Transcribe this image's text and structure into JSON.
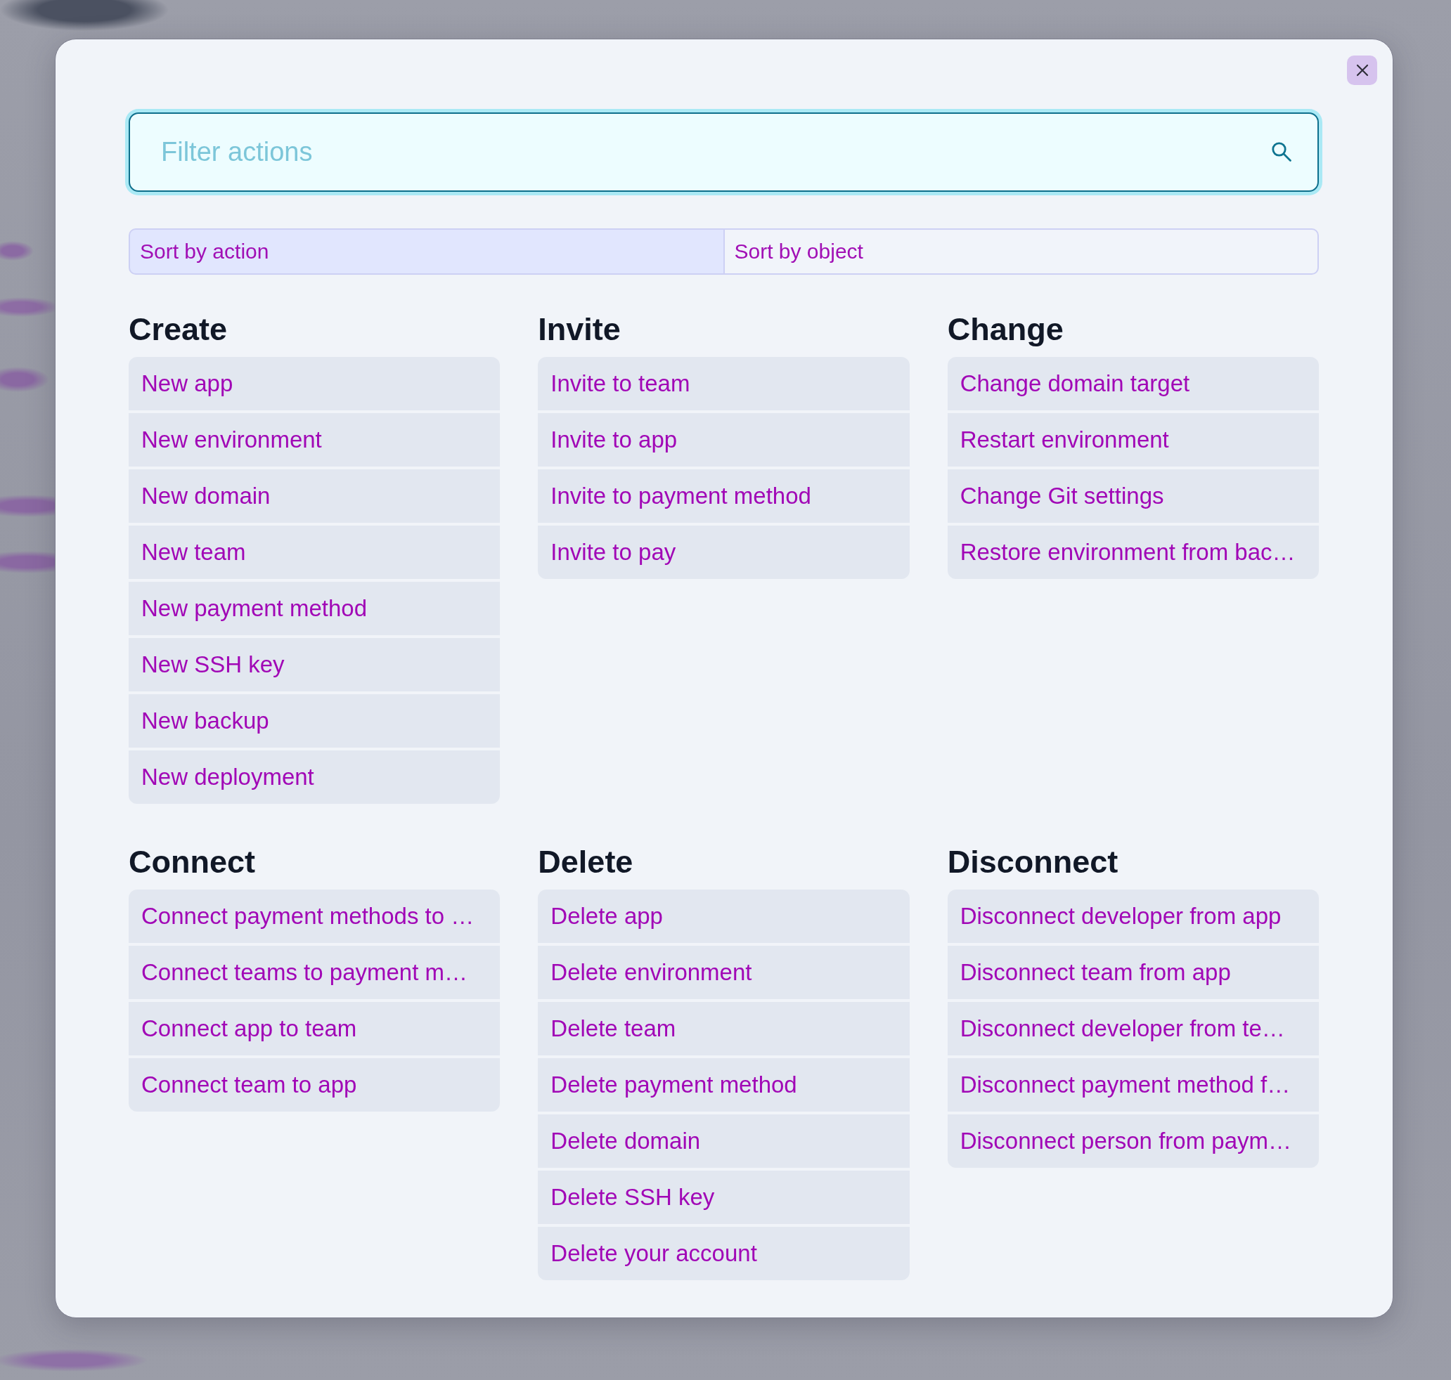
{
  "dialog": {
    "search": {
      "placeholder": "Filter actions"
    },
    "sort_tabs": [
      {
        "label": "Sort by action",
        "selected": true
      },
      {
        "label": "Sort by object",
        "selected": false
      }
    ],
    "groups": [
      {
        "heading": "Create",
        "actions": [
          "New app",
          "New environment",
          "New domain",
          "New team",
          "New payment method",
          "New SSH key",
          "New backup",
          "New deployment"
        ]
      },
      {
        "heading": "Invite",
        "actions": [
          "Invite to team",
          "Invite to app",
          "Invite to payment method",
          "Invite to pay"
        ]
      },
      {
        "heading": "Change",
        "actions": [
          "Change domain target",
          "Restart environment",
          "Change Git settings",
          "Restore environment from bac…"
        ]
      },
      {
        "heading": "Connect",
        "actions": [
          "Connect payment methods to …",
          "Connect teams to payment m…",
          "Connect app to team",
          "Connect team to app"
        ]
      },
      {
        "heading": "Delete",
        "actions": [
          "Delete app",
          "Delete environment",
          "Delete team",
          "Delete payment method",
          "Delete domain",
          "Delete SSH key",
          "Delete your account"
        ]
      },
      {
        "heading": "Disconnect",
        "actions": [
          "Disconnect developer from app",
          "Disconnect team from app",
          "Disconnect developer from te…",
          "Disconnect payment method f…",
          "Disconnect person from paym…"
        ]
      }
    ]
  }
}
